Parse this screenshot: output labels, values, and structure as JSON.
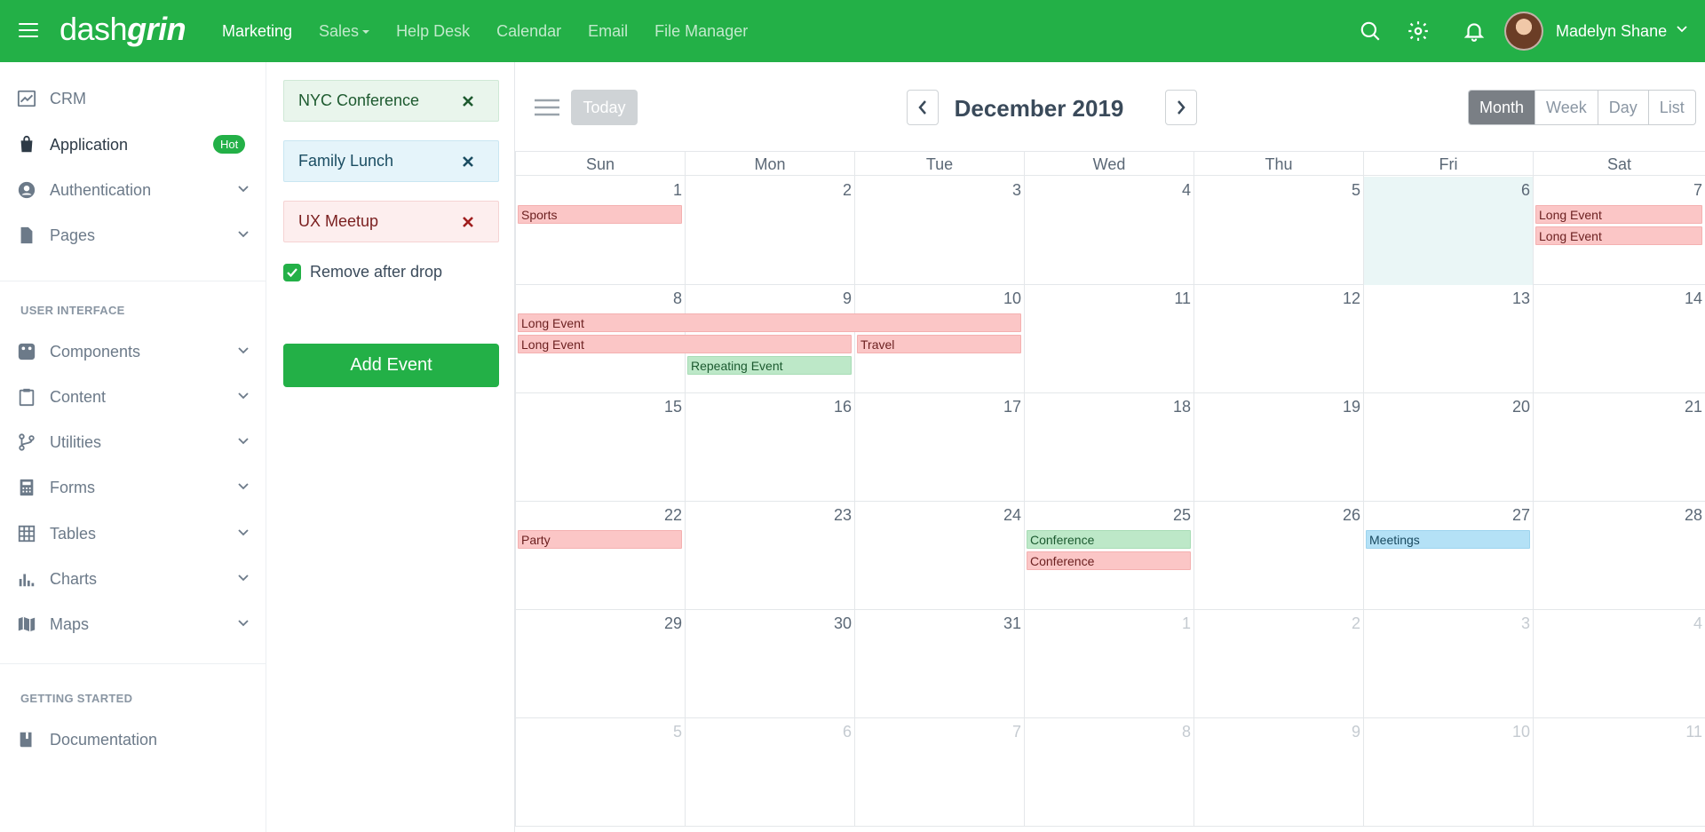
{
  "topbar": {
    "logo_light": "dash",
    "logo_bold": "grin",
    "nav": [
      {
        "label": "Marketing"
      },
      {
        "label": "Sales"
      },
      {
        "label": "Help Desk"
      },
      {
        "label": "Calendar"
      },
      {
        "label": "Email"
      },
      {
        "label": "File Manager"
      }
    ],
    "user_name": "Madelyn Shane"
  },
  "sidebar": {
    "items": [
      {
        "label": "CRM",
        "icon": "chart-line-icon"
      },
      {
        "label": "Application",
        "icon": "shopping-bag-icon",
        "badge": "Hot"
      },
      {
        "label": "Authentication",
        "icon": "user-circle-icon"
      },
      {
        "label": "Pages",
        "icon": "file-icon"
      }
    ],
    "section_ui": "USER INTERFACE",
    "ui_items": [
      {
        "label": "Components",
        "icon": "puzzle-icon"
      },
      {
        "label": "Content",
        "icon": "clipboard-icon"
      },
      {
        "label": "Utilities",
        "icon": "git-branch-icon"
      },
      {
        "label": "Forms",
        "icon": "calculator-icon"
      },
      {
        "label": "Tables",
        "icon": "grid-icon"
      },
      {
        "label": "Charts",
        "icon": "bar-chart-icon"
      },
      {
        "label": "Maps",
        "icon": "map-icon"
      }
    ],
    "section_started": "GETTING STARTED",
    "started_items": [
      {
        "label": "Documentation",
        "icon": "book-icon"
      }
    ]
  },
  "external_events": {
    "items": [
      {
        "label": "NYC Conference",
        "color": "green"
      },
      {
        "label": "Family Lunch",
        "color": "blue"
      },
      {
        "label": "UX Meetup",
        "color": "red"
      }
    ],
    "remove_after_drop_label": "Remove after drop",
    "remove_after_drop_checked": true,
    "add_button": "Add Event"
  },
  "calendar": {
    "today_label": "Today",
    "title": "December 2019",
    "views": [
      "Month",
      "Week",
      "Day",
      "List"
    ],
    "active_view": "Month",
    "weekdays": [
      "Sun",
      "Mon",
      "Tue",
      "Wed",
      "Thu",
      "Fri",
      "Sat"
    ],
    "weeks": [
      [
        "1",
        "2",
        "3",
        "4",
        "5",
        "6",
        "7"
      ],
      [
        "8",
        "9",
        "10",
        "11",
        "12",
        "13",
        "14"
      ],
      [
        "15",
        "16",
        "17",
        "18",
        "19",
        "20",
        "21"
      ],
      [
        "22",
        "23",
        "24",
        "25",
        "26",
        "27",
        "28"
      ],
      [
        "29",
        "30",
        "31",
        "1",
        "2",
        "3",
        "4"
      ],
      [
        "5",
        "6",
        "7",
        "8",
        "9",
        "10",
        "11"
      ]
    ],
    "events": [
      {
        "title": "Sports",
        "color": "red"
      },
      {
        "title": "Long Event",
        "color": "red"
      },
      {
        "title": "Long Event",
        "color": "red"
      },
      {
        "title": "Long Event",
        "color": "red"
      },
      {
        "title": "Long Event",
        "color": "red"
      },
      {
        "title": "Travel",
        "color": "red"
      },
      {
        "title": "Repeating Event",
        "color": "green"
      },
      {
        "title": "Party",
        "color": "red"
      },
      {
        "title": "Conference",
        "color": "green"
      },
      {
        "title": "Conference",
        "color": "red"
      },
      {
        "title": "Meetings",
        "color": "blue"
      }
    ]
  },
  "colors": {
    "brand": "#23b047",
    "event_red": "#fbc6c6",
    "event_green": "#bde8c8",
    "event_blue": "#b4e1f6",
    "today_bg": "#eaf6f6"
  }
}
